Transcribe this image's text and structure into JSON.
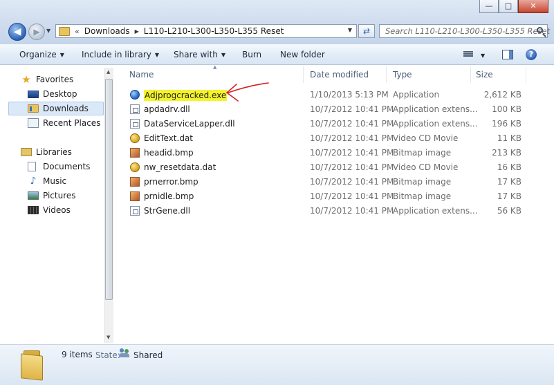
{
  "window": {
    "minimize_glyph": "—",
    "maximize_glyph": "□",
    "close_glyph": "✕"
  },
  "address_bar": {
    "overflow_glyph": "«",
    "segments": [
      "Downloads",
      "L110-L210-L300-L350-L355 Reset"
    ]
  },
  "search": {
    "placeholder": "Search L110-L210-L300-L350-L355 Reset"
  },
  "toolbar": {
    "organize": "Organize",
    "include_in_library": "Include in library",
    "share_with": "Share with",
    "burn": "Burn",
    "new_folder": "New folder",
    "help": "?"
  },
  "nav": {
    "favorites": "Favorites",
    "desktop": "Desktop",
    "downloads": "Downloads",
    "recent_places": "Recent Places",
    "libraries": "Libraries",
    "documents": "Documents",
    "music": "Music",
    "pictures": "Pictures",
    "videos": "Videos"
  },
  "columns": {
    "name": "Name",
    "date_modified": "Date modified",
    "type": "Type",
    "size": "Size"
  },
  "files": [
    {
      "name": "Adjprogcracked.exe",
      "date": "1/10/2013 5:13 PM",
      "type": "Application",
      "size": "2,612 KB",
      "icon": "exe-icon",
      "highlighted": true
    },
    {
      "name": "apdadrv.dll",
      "date": "10/7/2012 10:41 PM",
      "type": "Application extens...",
      "size": "100 KB",
      "icon": "dll-icon"
    },
    {
      "name": "DataServiceLapper.dll",
      "date": "10/7/2012 10:41 PM",
      "type": "Application extens...",
      "size": "196 KB",
      "icon": "dll-icon"
    },
    {
      "name": "EditText.dat",
      "date": "10/7/2012 10:41 PM",
      "type": "Video CD Movie",
      "size": "11 KB",
      "icon": "vcd-icon"
    },
    {
      "name": "headid.bmp",
      "date": "10/7/2012 10:41 PM",
      "type": "Bitmap image",
      "size": "213 KB",
      "icon": "bitmap-icon"
    },
    {
      "name": "nw_resetdata.dat",
      "date": "10/7/2012 10:41 PM",
      "type": "Video CD Movie",
      "size": "16 KB",
      "icon": "vcd-icon"
    },
    {
      "name": "prnerror.bmp",
      "date": "10/7/2012 10:41 PM",
      "type": "Bitmap image",
      "size": "17 KB",
      "icon": "bitmap-icon"
    },
    {
      "name": "prnidle.bmp",
      "date": "10/7/2012 10:41 PM",
      "type": "Bitmap image",
      "size": "17 KB",
      "icon": "bitmap-icon"
    },
    {
      "name": "StrGene.dll",
      "date": "10/7/2012 10:41 PM",
      "type": "Application extens...",
      "size": "56 KB",
      "icon": "dll-icon"
    }
  ],
  "details": {
    "count": "9 items",
    "state_label": "State:",
    "state_value": "Shared"
  },
  "colors": {
    "highlight": "#f4f42a",
    "annotation_arrow": "#d42020",
    "selection": "#dbe8f8"
  }
}
